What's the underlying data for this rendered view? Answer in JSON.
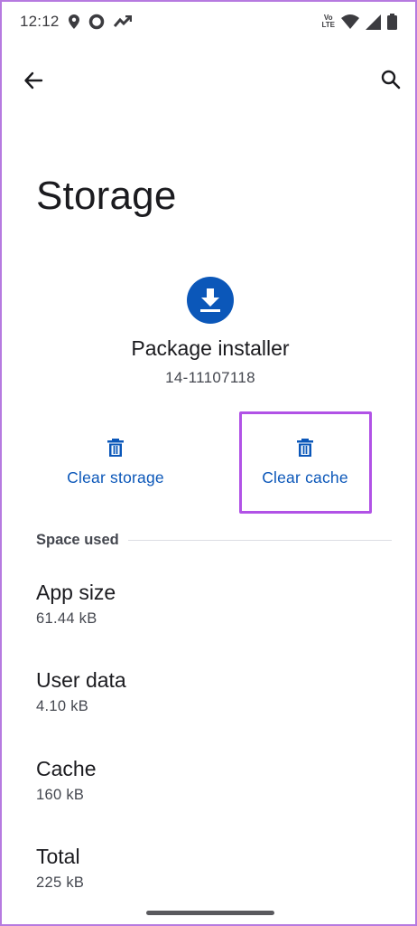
{
  "status_bar": {
    "time": "12:12",
    "network_label_top": "Vo",
    "network_label_bottom": "LTE"
  },
  "header": {
    "back_icon": "arrow-left-icon",
    "search_icon": "search-icon"
  },
  "page": {
    "title": "Storage"
  },
  "app": {
    "icon": "download-icon",
    "name": "Package installer",
    "version": "14-11107118",
    "accent_color": "#0b57b9"
  },
  "actions": {
    "clear_storage": "Clear storage",
    "clear_cache": "Clear cache",
    "icon": "trash-icon",
    "highlight_color": "#b152e6"
  },
  "space_used": {
    "header": "Space used",
    "items": [
      {
        "title": "App size",
        "value": "61.44 kB"
      },
      {
        "title": "User data",
        "value": "4.10 kB"
      },
      {
        "title": "Cache",
        "value": "160 kB"
      },
      {
        "title": "Total",
        "value": "225 kB"
      }
    ]
  }
}
